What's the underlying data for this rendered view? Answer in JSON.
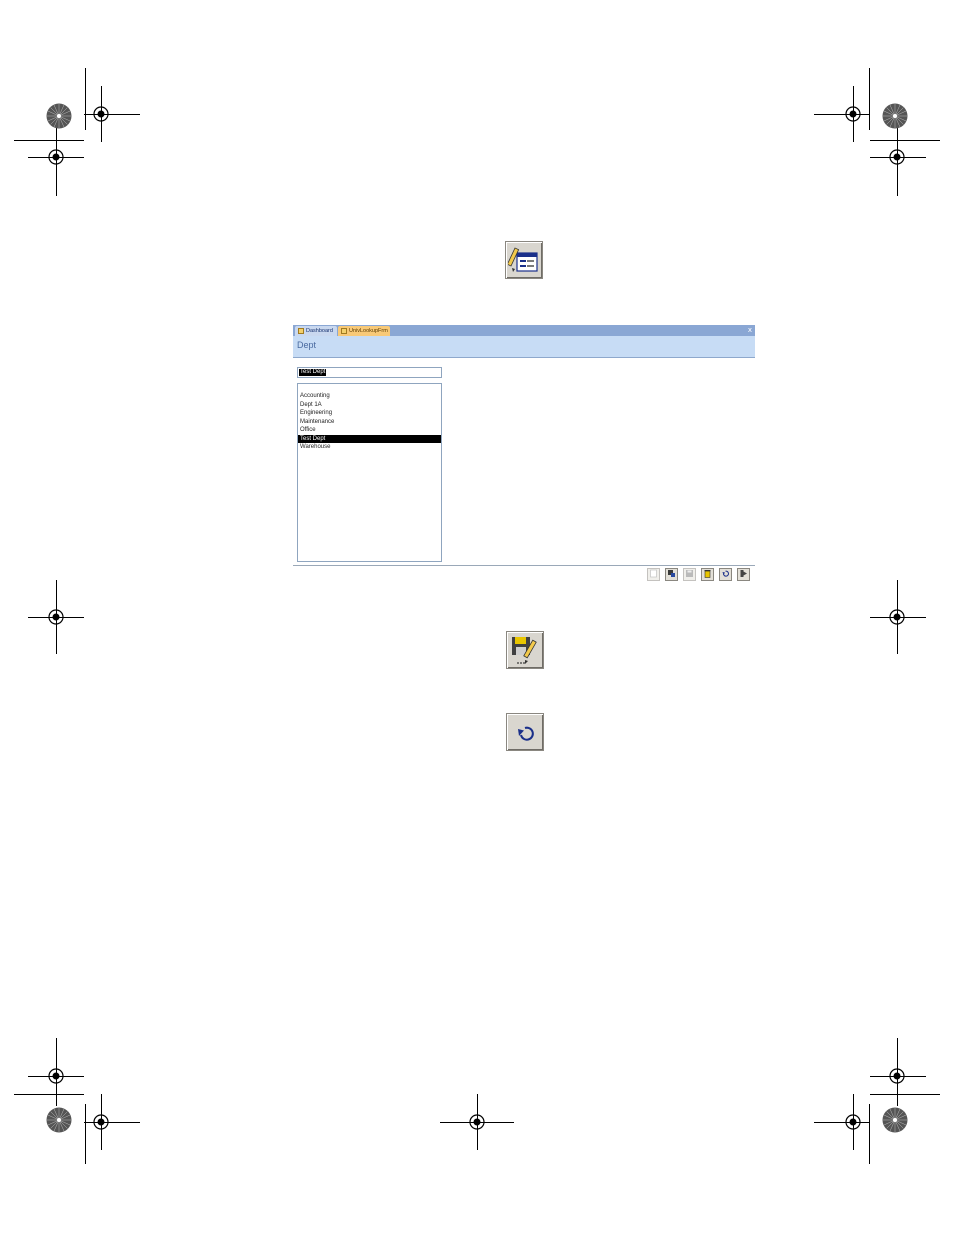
{
  "window": {
    "tabs": [
      {
        "label": "Dashboard"
      },
      {
        "label": "UnivLookupFrm"
      }
    ],
    "close_glyph": "x",
    "header_title": "Dept",
    "dept_field_value": "Test Dept",
    "list_items": [
      "Accounting",
      "Dept 1A",
      "Engineering",
      "Maintenance",
      "Office",
      "Test Dept",
      "Warehouse"
    ],
    "selected_item": "Test Dept"
  },
  "toolbar": {
    "buttons": [
      {
        "icon": "new-record-icon",
        "enabled": false
      },
      {
        "icon": "edit-record-icon",
        "enabled": true
      },
      {
        "icon": "save-record-icon",
        "enabled": false
      },
      {
        "icon": "delete-record-icon",
        "enabled": true
      },
      {
        "icon": "undo-icon",
        "enabled": true
      },
      {
        "icon": "exit-icon",
        "enabled": true
      }
    ]
  },
  "callout_icons": [
    "edit-form-icon",
    "save-edit-icon",
    "undo-icon"
  ],
  "colors": {
    "tab_bar": "#8aa7d4",
    "header_bg": "#c7dcf5",
    "active_tab": "#f8c977",
    "selection": "#000000"
  }
}
